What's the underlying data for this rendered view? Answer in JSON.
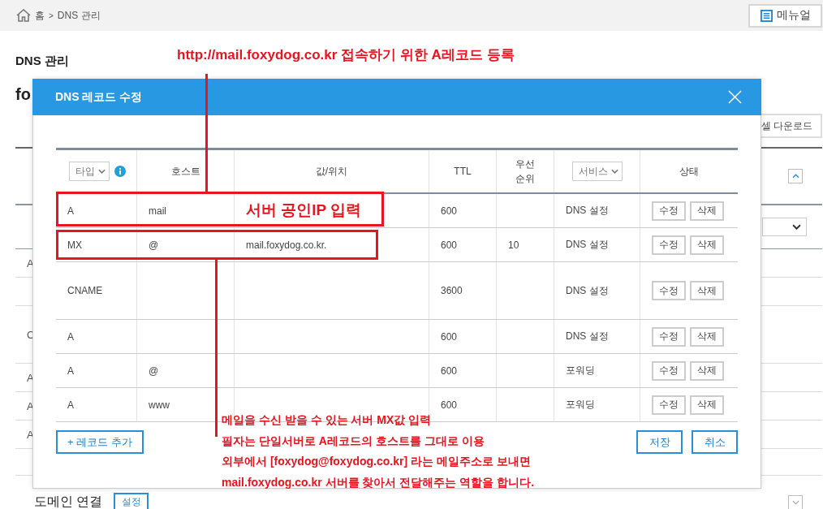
{
  "breadcrumb": {
    "home": "홈",
    "separator": ">",
    "current": "DNS 관리"
  },
  "manual_button": "메뉴얼",
  "page": {
    "heading": "DNS 관리",
    "domain_title": "fo",
    "excel_button": "셀 다운로드",
    "rows": [
      {
        "type": "A",
        "kind": "normal"
      },
      {
        "kind": "normal"
      },
      {
        "type": "C",
        "kind": "tall"
      },
      {
        "type": "A",
        "kind": "normal"
      },
      {
        "type": "A",
        "kind": "normal"
      },
      {
        "type": "A",
        "kind": "normal"
      }
    ],
    "domain_section": {
      "title": "도메인 연결",
      "button": "설정"
    }
  },
  "dialog": {
    "title": "DNS 레코드 수정",
    "columns": [
      {
        "label": "타입",
        "kind": "select"
      },
      {
        "label": "호스트",
        "kind": "text"
      },
      {
        "label": "값/위치",
        "kind": "text"
      },
      {
        "label": "TTL",
        "kind": "text"
      },
      {
        "label": "우선 순위",
        "kind": "text"
      },
      {
        "label": "서비스",
        "kind": "select"
      },
      {
        "label": "상태",
        "kind": "text"
      }
    ],
    "rows": [
      {
        "kind": "normal",
        "type": "A",
        "host": "mail",
        "value": "",
        "ttl": "600",
        "priority": "",
        "service": "DNS 설정",
        "edit": "수정",
        "delete": "삭제"
      },
      {
        "kind": "normal",
        "type": "MX",
        "host": "@",
        "value": "mail.foxydog.co.kr.",
        "ttl": "600",
        "priority": "10",
        "service": "DNS 설정",
        "edit": "수정",
        "delete": "삭제"
      },
      {
        "kind": "tall",
        "type": "CNAME",
        "host": "",
        "value": "",
        "ttl": "3600",
        "priority": "",
        "service": "DNS 설정",
        "edit": "수정",
        "delete": "삭제"
      },
      {
        "kind": "normal",
        "type": "A",
        "host": "",
        "value": "",
        "ttl": "600",
        "priority": "",
        "service": "DNS 설정",
        "edit": "수정",
        "delete": "삭제"
      },
      {
        "kind": "normal",
        "type": "A",
        "host": "@",
        "value": "",
        "ttl": "600",
        "priority": "",
        "service": "포워딩",
        "edit": "수정",
        "delete": "삭제"
      },
      {
        "kind": "normal",
        "type": "A",
        "host": "www",
        "value": "",
        "ttl": "600",
        "priority": "",
        "service": "포워딩",
        "edit": "수정",
        "delete": "삭제"
      }
    ],
    "add_button": "+ 레코드 추가",
    "save_button": "저장",
    "cancel_button": "취소"
  },
  "annotations": {
    "title": "http://mail.foxydog.co.kr 접속하기 위한 A레코드 등록",
    "row_note": "서버 공인IP 입력",
    "note_lines": [
      "메일을 수신 받을 수 있는 서버 MX값 입력",
      "필자는 단일서버로 A레코드의 호스트를 그대로 이용",
      "외부에서 [foxydog@foxydog.co.kr] 라는 메일주소로 보내면",
      "mail.foxydog.co.kr 서버를 찾아서 전달해주는 역할을 합니다."
    ]
  }
}
